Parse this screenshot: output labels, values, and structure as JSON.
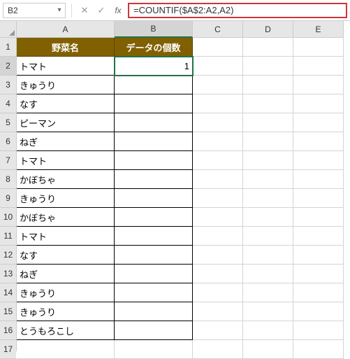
{
  "namebox": {
    "value": "B2"
  },
  "formula_bar": {
    "formula": "=COUNTIF($A$2:A2,A2)"
  },
  "icons": {
    "cancel": "✕",
    "enter": "✓",
    "fx": "fx",
    "chevron": "▾"
  },
  "columns": [
    "A",
    "B",
    "C",
    "D",
    "E"
  ],
  "row_numbers": [
    1,
    2,
    3,
    4,
    5,
    6,
    7,
    8,
    9,
    10,
    11,
    12,
    13,
    14,
    15,
    16,
    17
  ],
  "active_cell": "B2",
  "headers": {
    "a": "野菜名",
    "b": "データの個数"
  },
  "data": {
    "a": [
      "トマト",
      "きゅうり",
      "なす",
      "ピーマン",
      "ねぎ",
      "トマト",
      "かぼちゃ",
      "きゅうり",
      "かぼちゃ",
      "トマト",
      "なす",
      "ねぎ",
      "きゅうり",
      "きゅうり",
      "とうもろこし"
    ],
    "b": [
      "1",
      "",
      "",
      "",
      "",
      "",
      "",
      "",
      "",
      "",
      "",
      "",
      "",
      "",
      ""
    ]
  }
}
